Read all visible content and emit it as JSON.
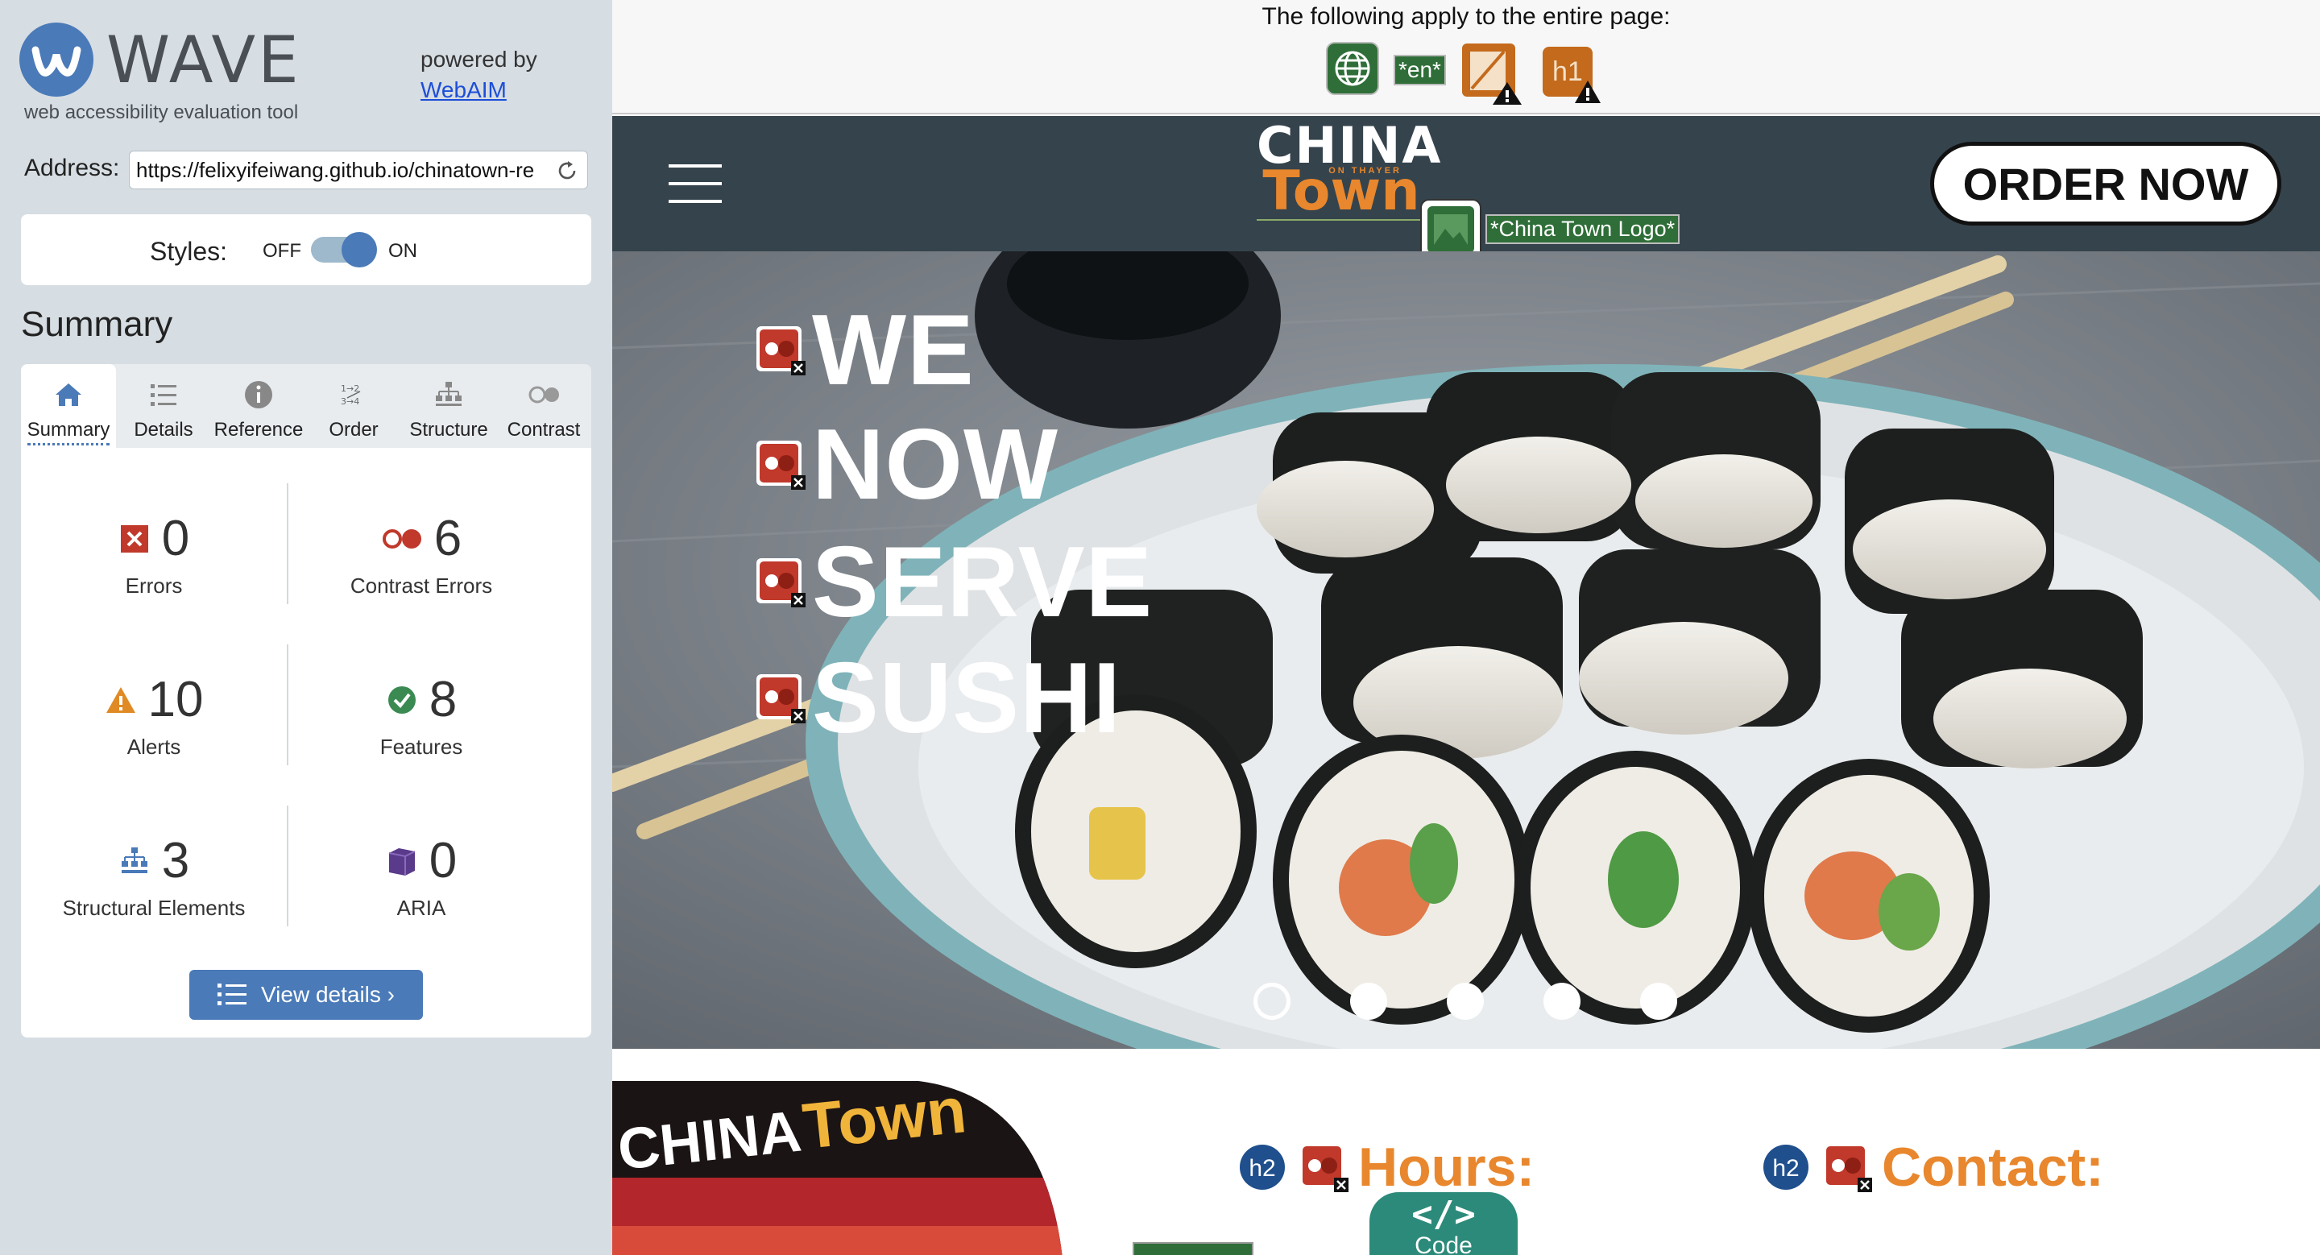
{
  "wave": {
    "title": "WAVE",
    "subtitle": "web accessibility evaluation tool",
    "powered_by": "powered by",
    "webaim_link": "WebAIM",
    "address_label": "Address:",
    "address_value": "https://felixyifeiwang.github.io/chinatown-re",
    "styles_label": "Styles:",
    "styles_off": "OFF",
    "styles_on": "ON",
    "styles_enabled": true,
    "summary_heading": "Summary",
    "tabs": [
      {
        "label": "Summary",
        "icon": "home-icon",
        "active": true
      },
      {
        "label": "Details",
        "icon": "list-icon",
        "active": false
      },
      {
        "label": "Reference",
        "icon": "info-icon",
        "active": false
      },
      {
        "label": "Order",
        "icon": "order-icon",
        "active": false
      },
      {
        "label": "Structure",
        "icon": "structure-icon",
        "active": false
      },
      {
        "label": "Contrast",
        "icon": "contrast-icon",
        "active": false
      }
    ],
    "stats": {
      "errors": {
        "value": "0",
        "label": "Errors",
        "icon": "error-x-icon",
        "color": "#c0392b"
      },
      "contrast_errors": {
        "value": "6",
        "label": "Contrast Errors",
        "icon": "contrast-error-icon",
        "color": "#c0392b"
      },
      "alerts": {
        "value": "10",
        "label": "Alerts",
        "icon": "alert-triangle-icon",
        "color": "#e08a26"
      },
      "features": {
        "value": "8",
        "label": "Features",
        "icon": "feature-check-icon",
        "color": "#3a8a52"
      },
      "structural": {
        "value": "3",
        "label": "Structural Elements",
        "icon": "structure-icon",
        "color": "#4a7ab8"
      },
      "aria": {
        "value": "0",
        "label": "ARIA",
        "icon": "aria-cube-icon",
        "color": "#5a3a8a"
      }
    },
    "view_details_label": "View details ›"
  },
  "page_level": {
    "text": "The following apply to the entire page:",
    "icons": [
      "language-globe-icon",
      "language-en-badge",
      "missing-title-alert-icon",
      "h1-alert-icon"
    ],
    "lang_badge": "*en*",
    "h1_badge": "h1"
  },
  "site": {
    "logo_china": "CHINA",
    "logo_on_thayer": "ON THAYER",
    "logo_town": "Town",
    "logo_alt": "*China Town Logo*",
    "order_now": "ORDER NOW",
    "hero_words": [
      "WE",
      "NOW",
      "SERVE",
      "SUSHI"
    ],
    "carousel_count": 5,
    "carousel_active": 0,
    "storefront_china": "CHINA",
    "storefront_town": "Town",
    "hours_title": "Hours:",
    "contact_title": "Contact:",
    "h2_badge": "h2",
    "code_symbol": "</>",
    "code_label": "Code"
  },
  "colors": {
    "wave_blue": "#4a7ab8",
    "header_bg": "#35434c",
    "brand_orange": "#e8872d",
    "contrast_red": "#c0392b",
    "feature_green": "#2f6e38",
    "code_teal": "#2c8a7a"
  }
}
